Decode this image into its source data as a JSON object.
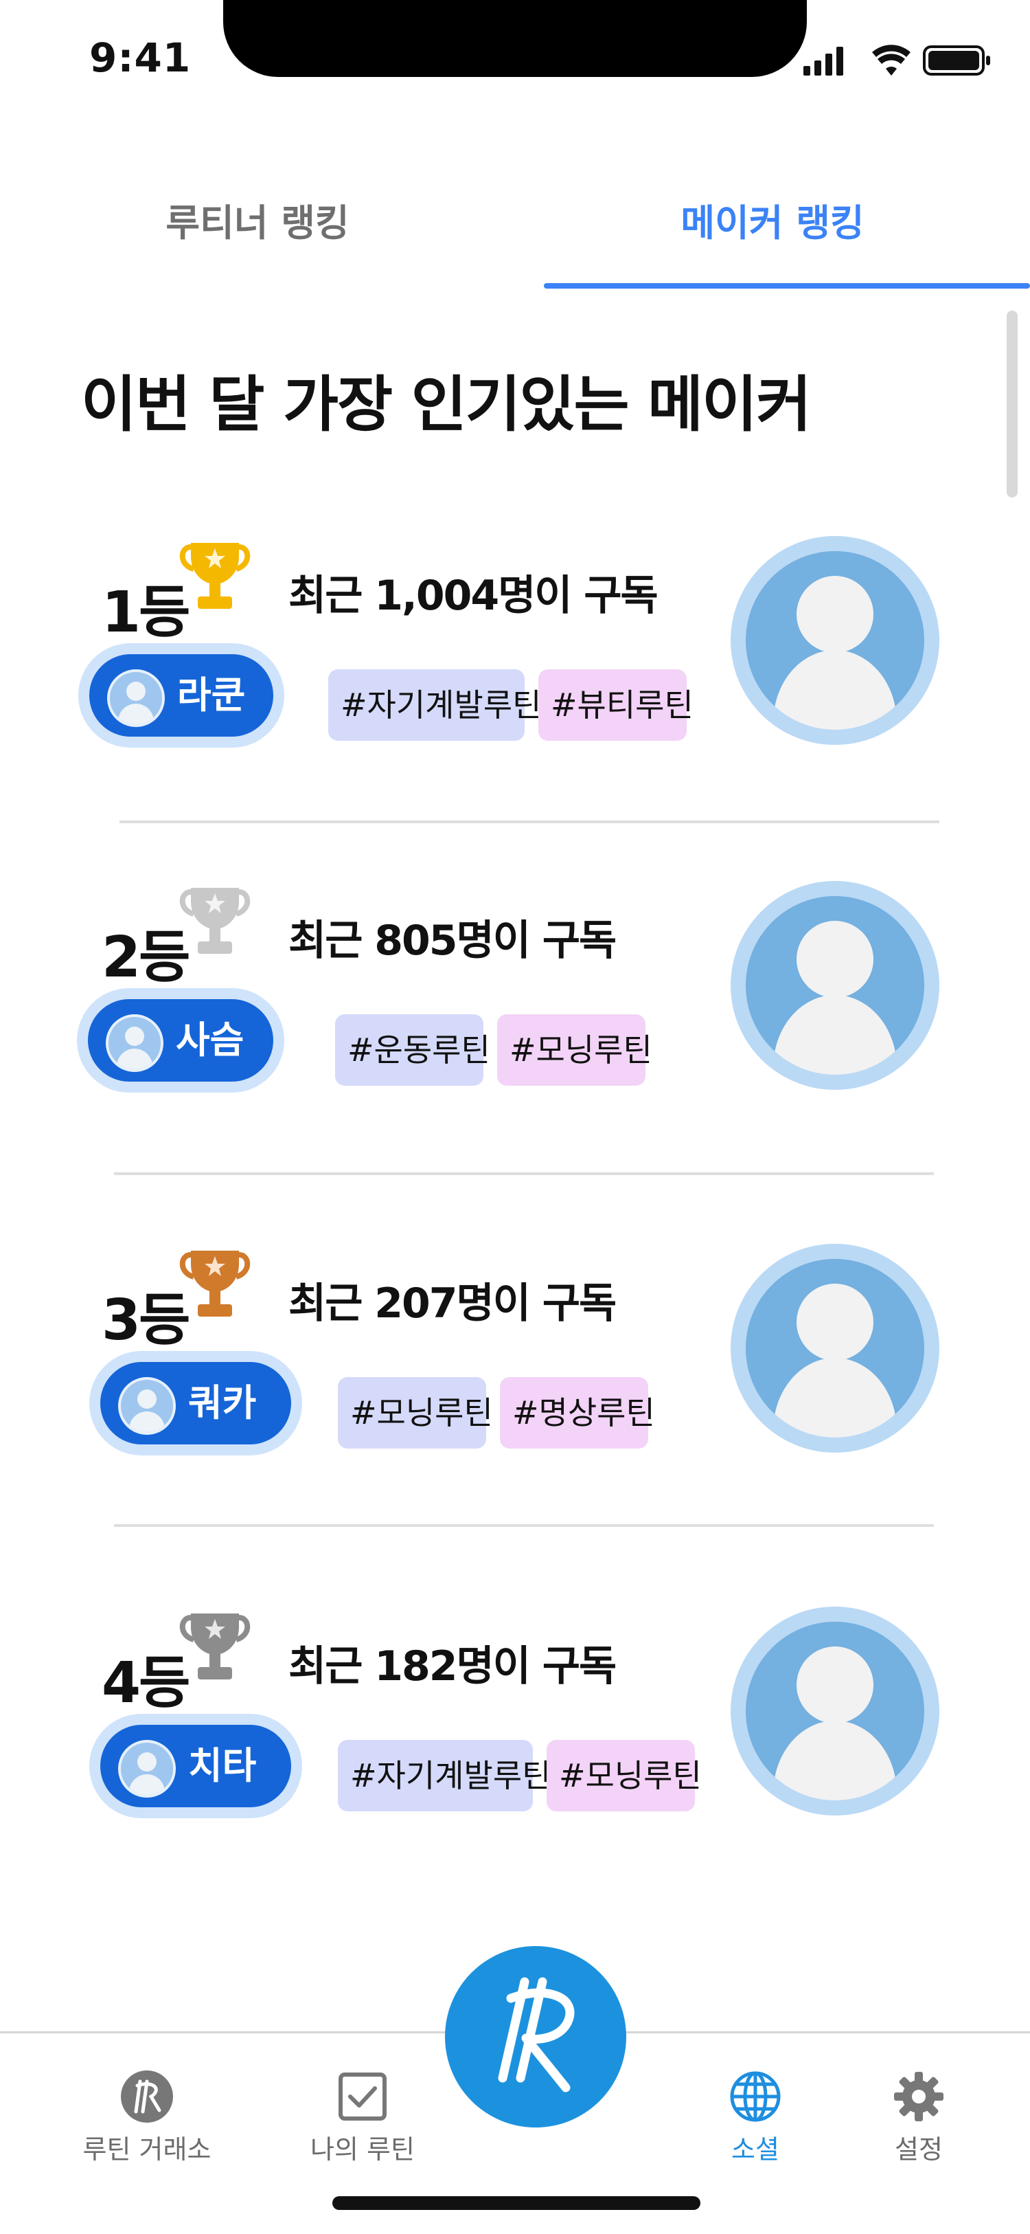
{
  "status_bar": {
    "time": "9:41"
  },
  "tabs": [
    {
      "label": "루티너 랭킹",
      "active": false
    },
    {
      "label": "메이커 랭킹",
      "active": true
    }
  ],
  "page_title": "이번 달 가장 인기있는 메이커",
  "colors": {
    "accent": "#3b82f6",
    "pill": "#1565d8",
    "gold": "#f5b800",
    "silver": "#c8c8c8",
    "bronze": "#d07a2c",
    "gray_trophy": "#8c8c8c"
  },
  "makers": [
    {
      "rank": "1등",
      "trophy": "gold-trophy-icon",
      "subscribers": "최근 1,004명이 구독",
      "name": "라쿤",
      "tags": [
        "#자기계발루틴",
        "#뷰티루틴"
      ]
    },
    {
      "rank": "2등",
      "trophy": "silver-trophy-icon",
      "subscribers": "최근 805명이 구독",
      "name": "사슴",
      "tags": [
        "#운동루틴",
        "#모닝루틴"
      ]
    },
    {
      "rank": "3등",
      "trophy": "bronze-trophy-icon",
      "subscribers": "최근 207명이 구독",
      "name": "쿼카",
      "tags": [
        "#모닝루틴",
        "#명상루틴"
      ]
    },
    {
      "rank": "4등",
      "trophy": "gray-trophy-icon",
      "subscribers": "최근 182명이 구독",
      "name": "치타",
      "tags": [
        "#자기계발루틴",
        "#모닝루틴"
      ]
    }
  ],
  "bottom_nav": {
    "items": [
      {
        "label": "루틴 거래소",
        "icon": "routine-market-icon",
        "active": false
      },
      {
        "label": "나의 루틴",
        "icon": "checkbox-icon",
        "active": false
      },
      {
        "label": "소셜",
        "icon": "globe-icon",
        "active": true
      },
      {
        "label": "설정",
        "icon": "gear-icon",
        "active": false
      }
    ],
    "center_icon": "routine-logo-icon"
  }
}
